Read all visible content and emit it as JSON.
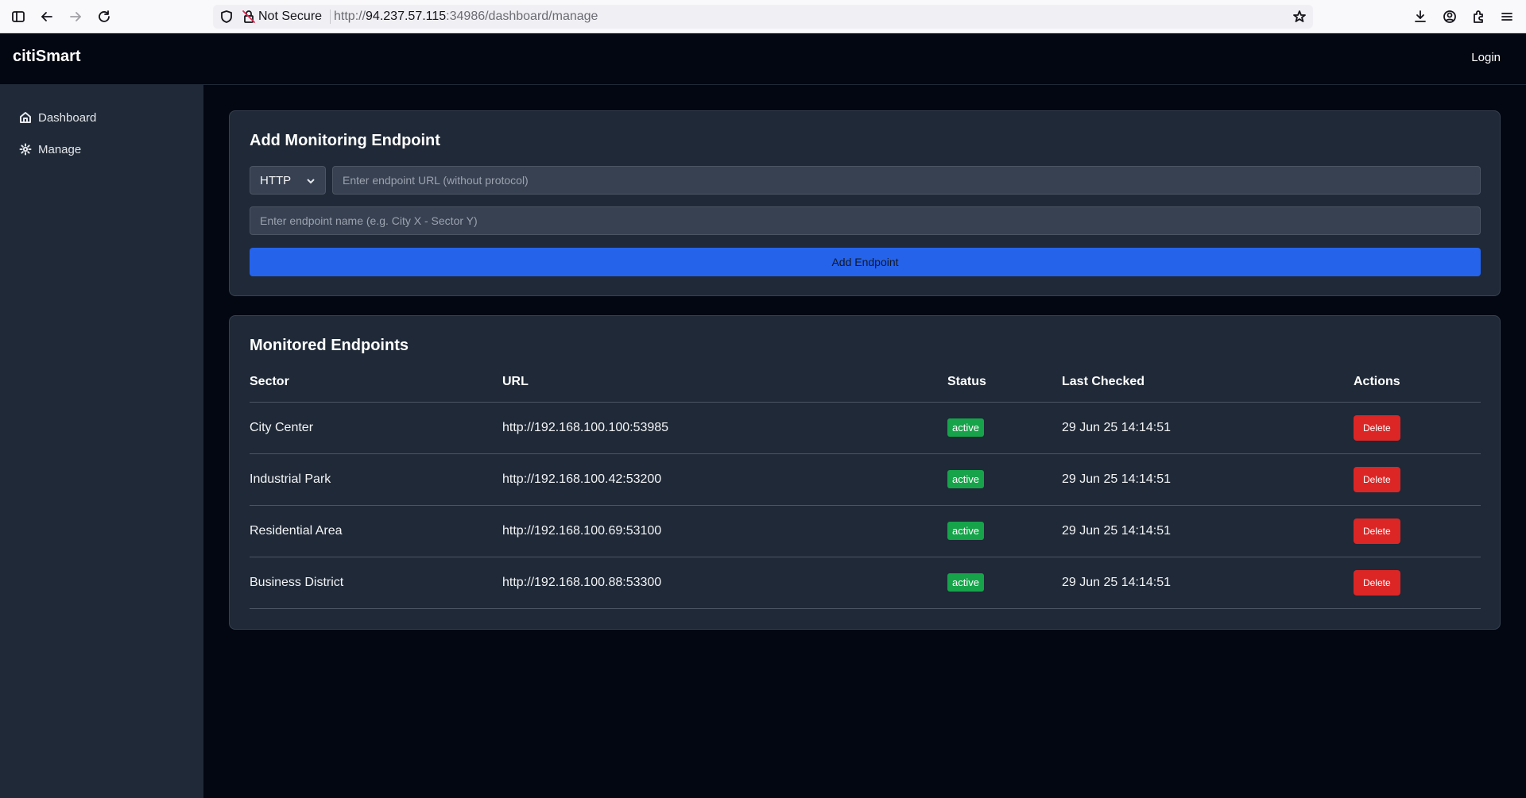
{
  "browser": {
    "security_label": "Not Secure",
    "url_prefix": "http://",
    "url_host": "94.237.57.115",
    "url_rest": ":34986/dashboard/manage"
  },
  "app": {
    "brand": "citiSmart",
    "login_label": "Login"
  },
  "sidebar": {
    "items": [
      {
        "label": "Dashboard",
        "icon": "home-icon"
      },
      {
        "label": "Manage",
        "icon": "gear-icon"
      }
    ]
  },
  "add_form": {
    "title": "Add Monitoring Endpoint",
    "protocol_selected": "HTTP",
    "url_placeholder": "Enter endpoint URL (without protocol)",
    "name_placeholder": "Enter endpoint name (e.g. City X - Sector Y)",
    "submit_label": "Add Endpoint"
  },
  "endpoints": {
    "title": "Monitored Endpoints",
    "columns": [
      "Sector",
      "URL",
      "Status",
      "Last Checked",
      "Actions"
    ],
    "rows": [
      {
        "sector": "City Center",
        "url": "http://192.168.100.100:53985",
        "status": "active",
        "last_checked": "29 Jun 25 14:14:51",
        "action": "Delete"
      },
      {
        "sector": "Industrial Park",
        "url": "http://192.168.100.42:53200",
        "status": "active",
        "last_checked": "29 Jun 25 14:14:51",
        "action": "Delete"
      },
      {
        "sector": "Residential Area",
        "url": "http://192.168.100.69:53100",
        "status": "active",
        "last_checked": "29 Jun 25 14:14:51",
        "action": "Delete"
      },
      {
        "sector": "Business District",
        "url": "http://192.168.100.88:53300",
        "status": "active",
        "last_checked": "29 Jun 25 14:14:51",
        "action": "Delete"
      }
    ]
  },
  "colors": {
    "primary": "#2563eb",
    "active": "#16a34a",
    "danger": "#dc2626",
    "panel": "#1f2937"
  }
}
